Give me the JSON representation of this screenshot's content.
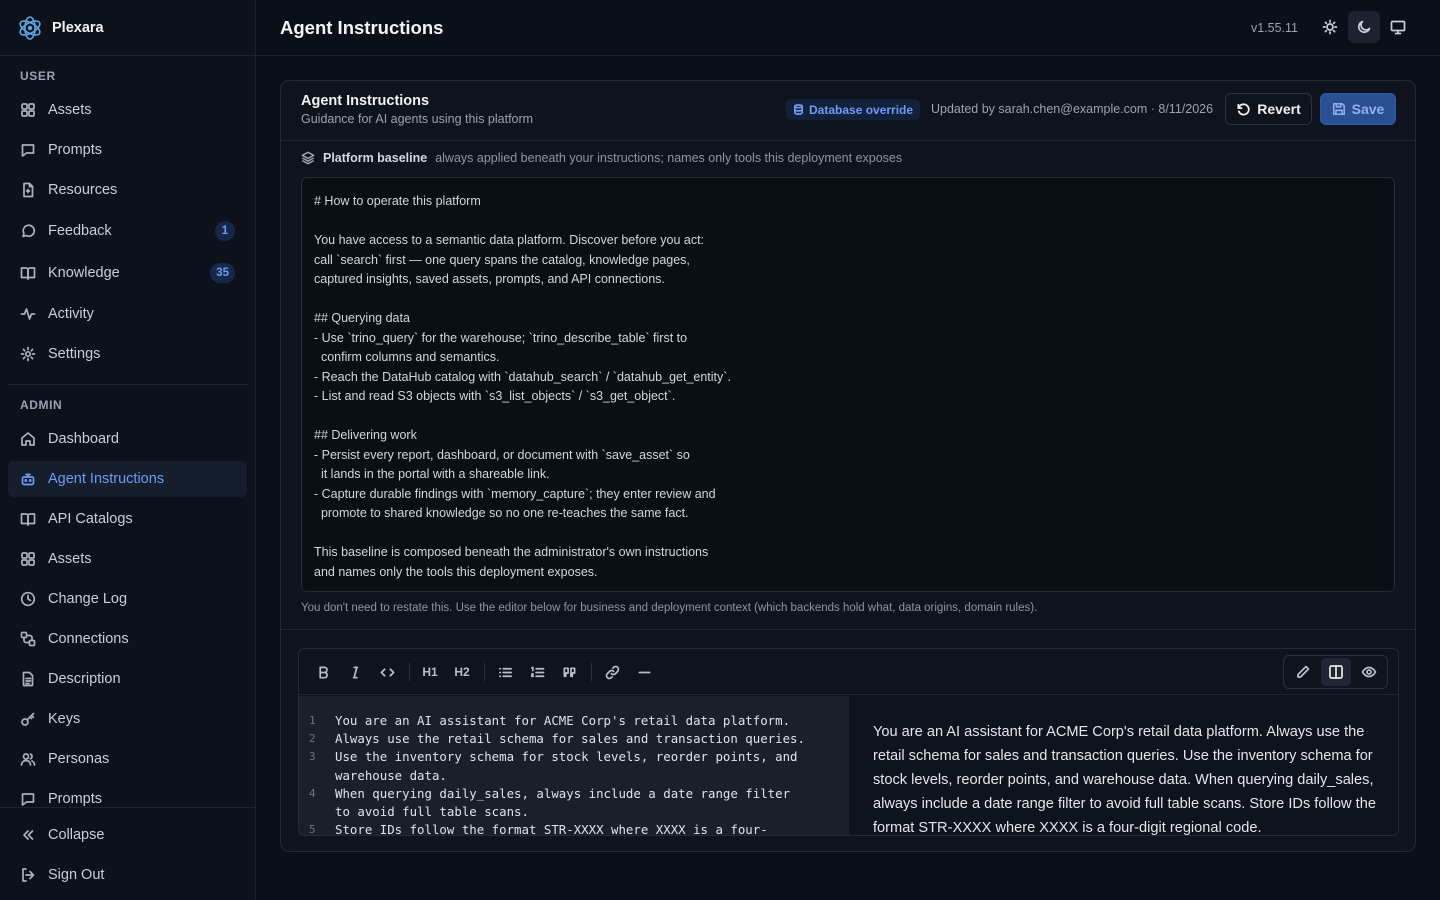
{
  "app": {
    "name": "Plexara",
    "page_title": "Agent Instructions",
    "version": "v1.55.11"
  },
  "sidebar": {
    "user_label": "USER",
    "admin_label": "ADMIN",
    "user_items": [
      {
        "label": "Assets",
        "icon": "grid-icon"
      },
      {
        "label": "Prompts",
        "icon": "message-square-icon"
      },
      {
        "label": "Resources",
        "icon": "file-icon"
      },
      {
        "label": "Feedback",
        "icon": "message-circle-icon",
        "badge": "1"
      },
      {
        "label": "Knowledge",
        "icon": "book-open-icon",
        "badge": "35"
      },
      {
        "label": "Activity",
        "icon": "activity-icon"
      },
      {
        "label": "Settings",
        "icon": "gear-icon"
      }
    ],
    "admin_items": [
      {
        "label": "Dashboard",
        "icon": "home-icon"
      },
      {
        "label": "Agent Instructions",
        "icon": "bot-icon",
        "active": true
      },
      {
        "label": "API Catalogs",
        "icon": "book-open-icon"
      },
      {
        "label": "Assets",
        "icon": "grid-icon"
      },
      {
        "label": "Change Log",
        "icon": "clock-icon"
      },
      {
        "label": "Connections",
        "icon": "connections-icon"
      },
      {
        "label": "Description",
        "icon": "file-text-icon"
      },
      {
        "label": "Keys",
        "icon": "key-icon"
      },
      {
        "label": "Personas",
        "icon": "users-icon"
      },
      {
        "label": "Prompts",
        "icon": "message-square-icon"
      }
    ],
    "collapse_label": "Collapse",
    "signout_label": "Sign Out"
  },
  "card": {
    "title": "Agent Instructions",
    "subtitle": "Guidance for AI agents using this platform",
    "override_badge": "Database override",
    "updated": "Updated by sarah.chen@example.com · 8/11/2026",
    "revert_label": "Revert",
    "save_label": "Save"
  },
  "baseline": {
    "label": "Platform baseline",
    "description": "always applied beneath your instructions; names only tools this deployment exposes",
    "lines": [
      "# How to operate this platform",
      "",
      "You have access to a semantic data platform. Discover before you act:",
      "call `search` first — one query spans the catalog, knowledge pages,",
      "captured insights, saved assets, prompts, and API connections.",
      "",
      "## Querying data",
      "- Use `trino_query` for the warehouse; `trino_describe_table` first to",
      "  confirm columns and semantics.",
      "- Reach the DataHub catalog with `datahub_search` / `datahub_get_entity`.",
      "- List and read S3 objects with `s3_list_objects` / `s3_get_object`.",
      "",
      "## Delivering work",
      "- Persist every report, dashboard, or document with `save_asset` so",
      "  it lands in the portal with a shareable link.",
      "- Capture durable findings with `memory_capture`; they enter review and",
      "  promote to shared knowledge so no one re-teaches the same fact.",
      "",
      "This baseline is composed beneath the administrator's own instructions",
      "and names only the tools this deployment exposes."
    ],
    "note": "You don't need to restate this. Use the editor below for business and deployment context (which backends hold what, data origins, domain rules)."
  },
  "editor": {
    "toolbar": {
      "bold": "bold-icon",
      "italic": "italic-icon",
      "code": "code-icon",
      "h1": "H1",
      "h2": "H2",
      "bullet_list": "list-icon",
      "ordered_list": "ordered-list-icon",
      "quote": "quote-icon",
      "link": "link-icon",
      "hr": "horizontal-rule-icon"
    },
    "view_modes": [
      "edit-icon",
      "split-icon",
      "preview-icon"
    ],
    "active_view": "split",
    "code_lines": [
      {
        "n": "1",
        "text": "You are an AI assistant for ACME Corp's retail data platform."
      },
      {
        "n": "2",
        "text": "Always use the retail schema for sales and transaction queries."
      },
      {
        "n": "3",
        "text": "Use the inventory schema for stock levels, reorder points, and"
      },
      {
        "n": "",
        "text": "warehouse data."
      },
      {
        "n": "4",
        "text": "When querying daily_sales, always include a date range filter"
      },
      {
        "n": "",
        "text": "to avoid full table scans."
      },
      {
        "n": "5",
        "text": "Store IDs follow the format STR-XXXX where XXXX is a four-"
      }
    ],
    "preview_text": "You are an AI assistant for ACME Corp's retail data platform. Always use the retail schema for sales and transaction queries. Use the inventory schema for stock levels, reorder points, and warehouse data. When querying daily_sales, always include a date range filter to avoid full table scans. Store IDs follow the format STR-XXXX where XXXX is a four-digit regional code."
  },
  "colors": {
    "accent": "#6f9bf6",
    "background": "#0b0f17",
    "save_button": "#2a4f93"
  }
}
